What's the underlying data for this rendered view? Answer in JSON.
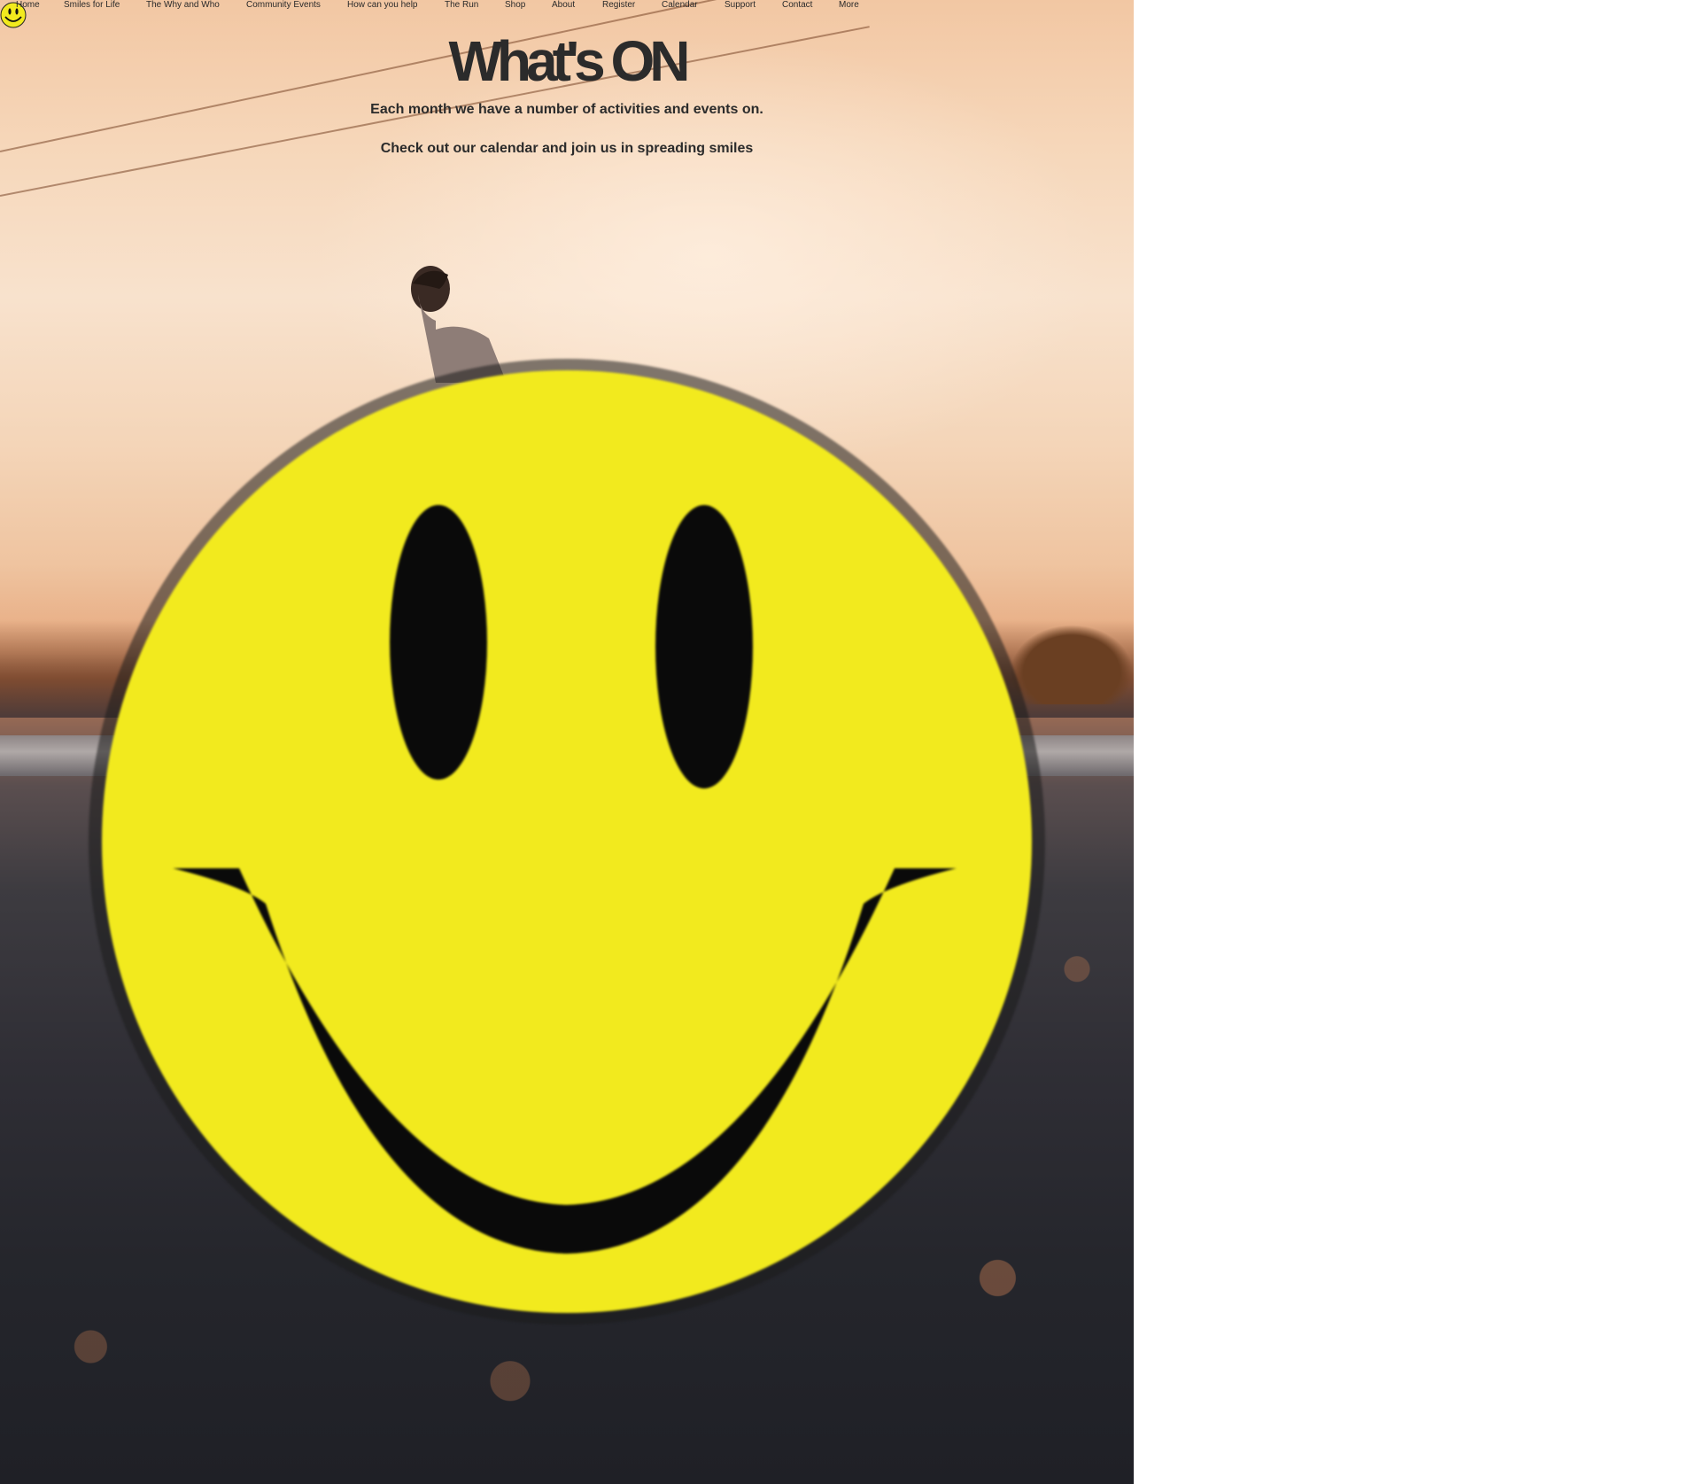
{
  "nav": {
    "logo_icon": "smiley-face-icon",
    "items": [
      "Home",
      "Smiles for Life",
      "The Why and Who",
      "Community Events",
      "How can you help",
      "The Run",
      "Shop",
      "About",
      "Register",
      "Calendar",
      "Support",
      "Contact",
      "More"
    ]
  },
  "hero": {
    "title": "What's ON",
    "line1": "Each month we have a number of activities and events on.",
    "line2": "Check out our calendar and join us in spreading smiles",
    "colors": {
      "smiley_yellow": "#f2ea1e",
      "smiley_outline": "#141414",
      "text": "#2b2b2b"
    }
  }
}
